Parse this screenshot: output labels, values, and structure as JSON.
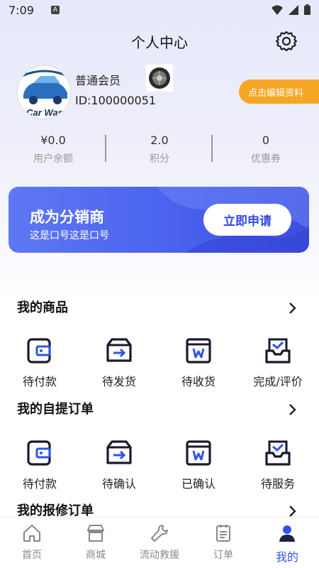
{
  "status_bar": {
    "time": "7:09",
    "a_badge": "A"
  },
  "header": {
    "title": "个人中心"
  },
  "profile": {
    "member_level": "普通会员",
    "user_id": "ID:100000051",
    "avatar_text": "Car Was",
    "edit_label": "点击编辑资料"
  },
  "stats": [
    {
      "value": "¥0.0",
      "label": "用户余额"
    },
    {
      "value": "2.0",
      "label": "积分"
    },
    {
      "value": "0",
      "label": "优惠券"
    }
  ],
  "banner": {
    "title": "成为分销商",
    "subtitle": "这是口号这是口号",
    "button": "立即申请"
  },
  "sections": [
    {
      "title": "我的商品",
      "items": [
        {
          "label": "待付款",
          "icon": "wallet-icon"
        },
        {
          "label": "待发货",
          "icon": "ship-box-icon"
        },
        {
          "label": "待收货",
          "icon": "receive-box-icon"
        },
        {
          "label": "完成/评价",
          "icon": "check-tray-icon"
        }
      ]
    },
    {
      "title": "我的自提订单",
      "items": [
        {
          "label": "待付款",
          "icon": "wallet-icon"
        },
        {
          "label": "待确认",
          "icon": "ship-box-icon"
        },
        {
          "label": "已确认",
          "icon": "receive-box-icon"
        },
        {
          "label": "待服务",
          "icon": "check-tray-icon"
        }
      ]
    },
    {
      "title": "我的报修订单",
      "items": []
    }
  ],
  "tabbar": [
    {
      "label": "首页",
      "icon": "home-icon"
    },
    {
      "label": "商城",
      "icon": "store-icon"
    },
    {
      "label": "流动救援",
      "icon": "wrench-icon"
    },
    {
      "label": "订单",
      "icon": "order-list-icon"
    },
    {
      "label": "我的",
      "icon": "user-icon",
      "active": true
    }
  ],
  "colors": {
    "accent": "#2f55e8",
    "edit_button": "#f5a623",
    "banner_start": "#5e78f3",
    "banner_end": "#3b4fe0"
  }
}
